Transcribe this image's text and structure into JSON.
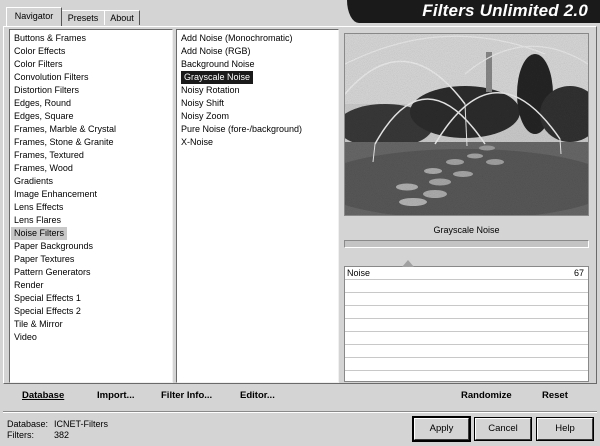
{
  "app": {
    "title": "Filters Unlimited 2.0"
  },
  "tabs": [
    {
      "label": "Navigator",
      "active": true
    },
    {
      "label": "Presets",
      "active": false
    },
    {
      "label": "About",
      "active": false
    }
  ],
  "categories": [
    "Buttons & Frames",
    "Color Effects",
    "Color Filters",
    "Convolution Filters",
    "Distortion Filters",
    "Edges, Round",
    "Edges, Square",
    "Frames, Marble & Crystal",
    "Frames, Stone & Granite",
    "Frames, Textured",
    "Frames, Wood",
    "Gradients",
    "Image Enhancement",
    "Lens Effects",
    "Lens Flares",
    "Noise Filters",
    "Paper Backgrounds",
    "Paper Textures",
    "Pattern Generators",
    "Render",
    "Special Effects 1",
    "Special Effects 2",
    "Tile & Mirror",
    "Video"
  ],
  "selected_category": "Noise Filters",
  "filters": [
    "Add Noise (Monochromatic)",
    "Add Noise (RGB)",
    "Background Noise",
    "Grayscale Noise",
    "Noisy Rotation",
    "Noisy Shift",
    "Noisy Zoom",
    "Pure Noise (fore-/background)",
    "X-Noise"
  ],
  "selected_filter": "Grayscale Noise",
  "preview": {
    "caption": "Grayscale Noise"
  },
  "params": [
    {
      "label": "Noise",
      "value": "67",
      "level": 0.26
    }
  ],
  "commands": {
    "database": "Database",
    "import": "Import...",
    "filter_info": "Filter Info...",
    "editor": "Editor...",
    "randomize": "Randomize",
    "reset": "Reset"
  },
  "status": {
    "database_label": "Database:",
    "database_value": "ICNET-Filters",
    "filters_label": "Filters:",
    "filters_value": "382"
  },
  "buttons": {
    "apply": "Apply",
    "cancel": "Cancel",
    "help": "Help"
  }
}
